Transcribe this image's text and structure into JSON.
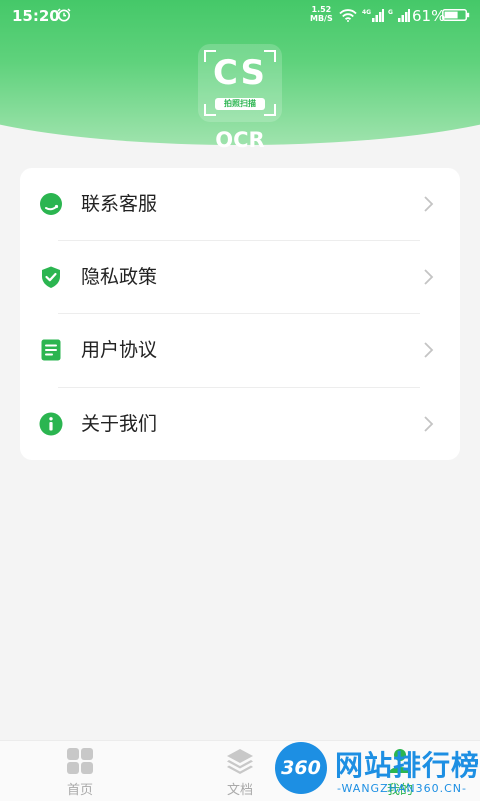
{
  "status_bar": {
    "time": "15:20",
    "net_speed": "1.52",
    "net_speed_unit": "MB/S",
    "network_label": "4G",
    "battery": "61%"
  },
  "header": {
    "logo_text": "CS",
    "logo_subtitle": "拍照扫描",
    "app_name": "OCR",
    "accent_color": "#34c25c"
  },
  "menu": {
    "items": [
      {
        "label": "联系客服",
        "icon": "headset-icon"
      },
      {
        "label": "隐私政策",
        "icon": "shield-check-icon"
      },
      {
        "label": "用户协议",
        "icon": "document-icon"
      },
      {
        "label": "关于我们",
        "icon": "info-icon"
      }
    ]
  },
  "bottom_nav": {
    "items": [
      {
        "label": "首页",
        "icon": "grid-icon"
      },
      {
        "label": "文档",
        "icon": "layers-icon"
      },
      {
        "label": "我的",
        "icon": "user-icon"
      }
    ]
  },
  "watermark": {
    "badge": "360",
    "title": "网站排行榜",
    "url": "-WANGZHAN360.CN-"
  }
}
